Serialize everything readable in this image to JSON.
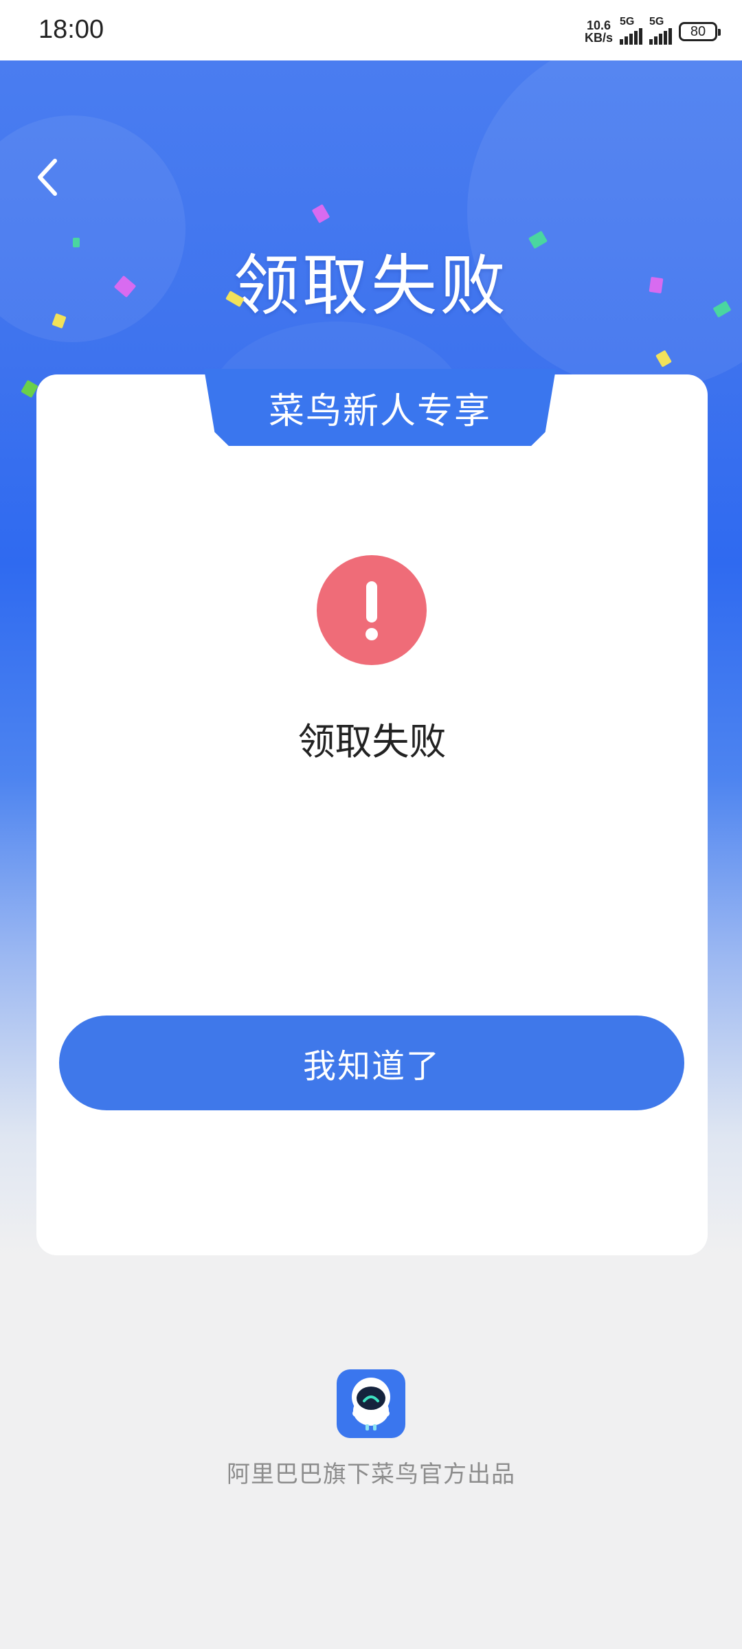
{
  "status_bar": {
    "time": "18:00",
    "net_speed_value": "10.6",
    "net_speed_unit": "KB/s",
    "signal1_label": "5G",
    "signal2_label": "5G",
    "battery": "80"
  },
  "header": {
    "back_icon": "chevron-left-icon",
    "title": "领取失败"
  },
  "card": {
    "tab_label": "菜鸟新人专享",
    "alert_icon": "exclamation-icon",
    "status_text": "领取失败",
    "button_label": "我知道了"
  },
  "footer": {
    "logo_icon": "cainiao-mascot-icon",
    "text": "阿里巴巴旗下菜鸟官方出品"
  },
  "colors": {
    "primary": "#3a76ee",
    "alert": "#ef6c78",
    "background": "#f0f0f1"
  }
}
